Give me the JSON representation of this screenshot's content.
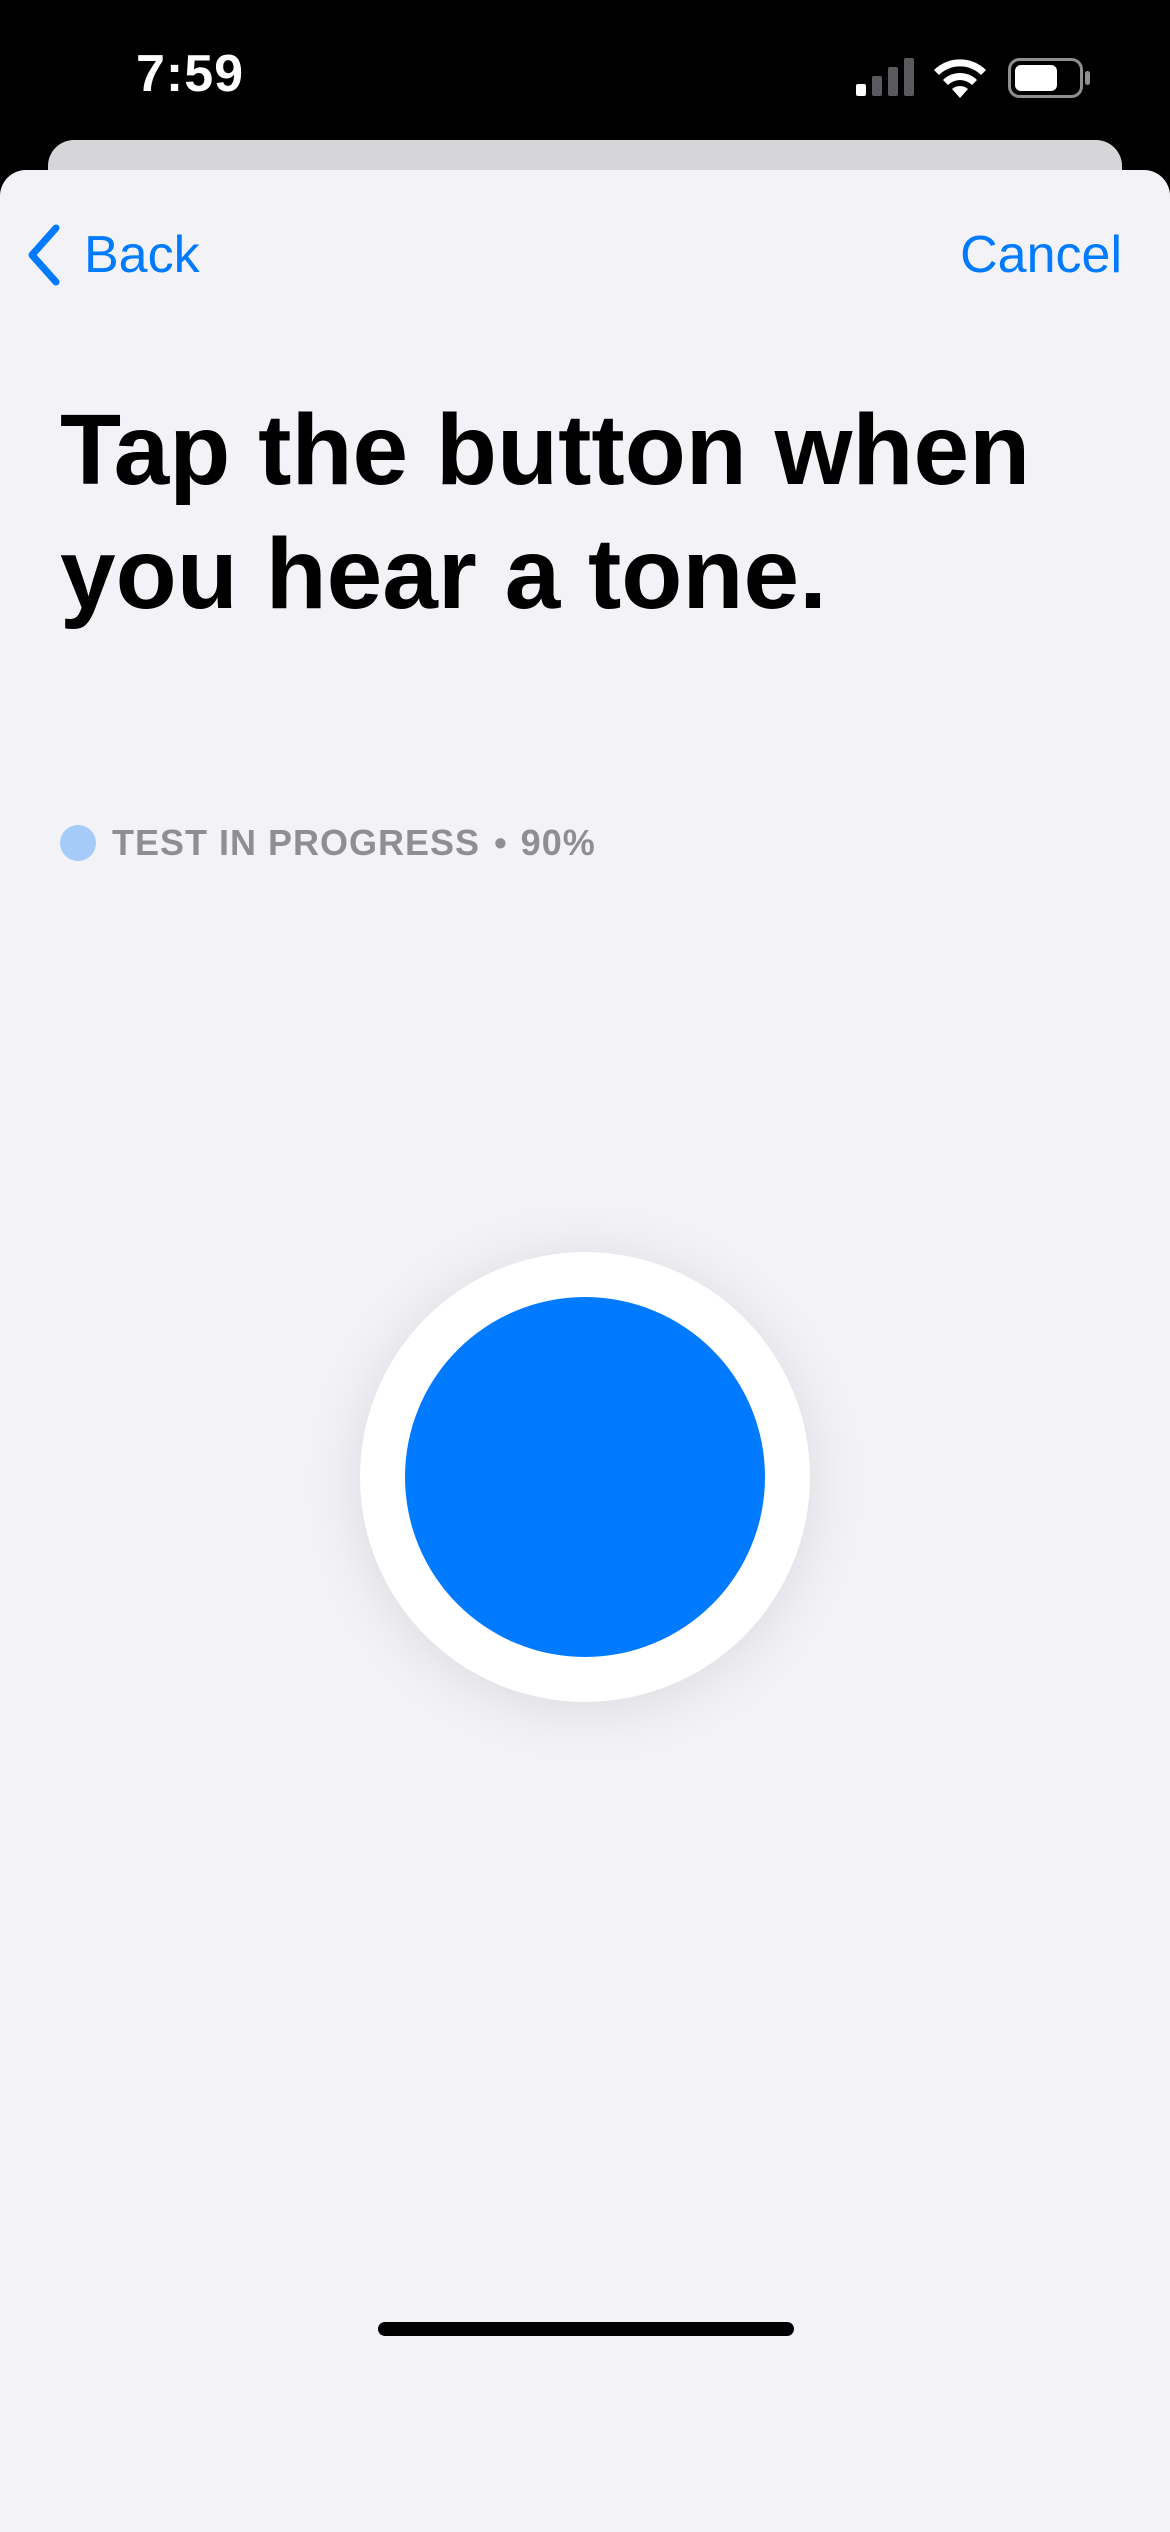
{
  "status_bar": {
    "time": "7:59",
    "icons": [
      "cellular-signal-icon",
      "wifi-icon",
      "battery-icon"
    ]
  },
  "nav": {
    "back_label": "Back",
    "cancel_label": "Cancel"
  },
  "headline": "Tap the button when you hear a tone.",
  "progress": {
    "label": "TEST IN PROGRESS",
    "separator": "•",
    "value_text": "90%",
    "value": 0.9
  },
  "colors": {
    "accent": "#007aff",
    "progress_dot": "#a4cbfa",
    "background": "#f2f2f7",
    "secondary_text": "#8e8e93"
  }
}
